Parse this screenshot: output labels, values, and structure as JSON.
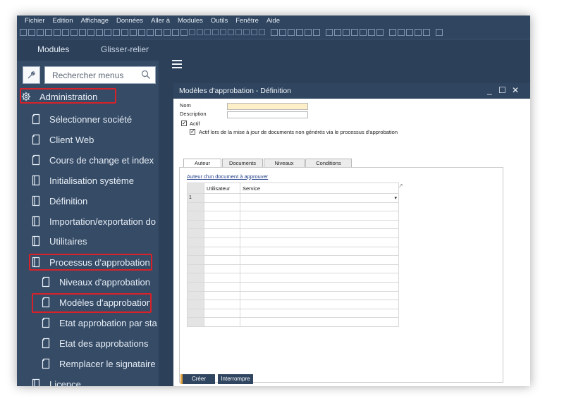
{
  "menubar": {
    "items": [
      "Fichier",
      "Edition",
      "Affichage",
      "Données",
      "Aller à",
      "Modules",
      "Outils",
      "Fenêtre",
      "Aide"
    ]
  },
  "sidebar": {
    "tabs": {
      "active": "Modules",
      "other": "Glisser-relier"
    },
    "search_placeholder": "Rechercher menus",
    "items": [
      {
        "label": "Administration",
        "level": 0,
        "icon": "gear-icon",
        "highlighted": true
      },
      {
        "label": "Sélectionner société",
        "level": 1,
        "icon": "document-icon"
      },
      {
        "label": "Client Web",
        "level": 1,
        "icon": "document-icon"
      },
      {
        "label": "Cours de change et index",
        "level": 1,
        "icon": "document-icon"
      },
      {
        "label": "Initialisation système",
        "level": 1,
        "icon": "folder-icon"
      },
      {
        "label": "Définition",
        "level": 1,
        "icon": "folder-icon"
      },
      {
        "label": "Importation/exportation do",
        "level": 1,
        "icon": "folder-icon"
      },
      {
        "label": "Utilitaires",
        "level": 1,
        "icon": "folder-icon"
      },
      {
        "label": "Processus d'approbation",
        "level": 1,
        "icon": "folder-icon",
        "highlighted": true
      },
      {
        "label": "Niveaux d'approbation",
        "level": 2,
        "icon": "document-icon"
      },
      {
        "label": "Modèles d'approbation",
        "level": 2,
        "icon": "document-icon",
        "highlighted": true
      },
      {
        "label": "Etat approbation par sta",
        "level": 2,
        "icon": "document-icon"
      },
      {
        "label": "Etat des approbations",
        "level": 2,
        "icon": "document-icon"
      },
      {
        "label": "Remplacer le signataire",
        "level": 2,
        "icon": "document-icon"
      },
      {
        "label": "Licence",
        "level": 1,
        "icon": "folder-icon"
      }
    ]
  },
  "window": {
    "title": "Modèles d'approbation - Définition",
    "controls": {
      "minimize": "_",
      "maximize": "☐",
      "close": "✕"
    },
    "fields": {
      "nom_label": "Nom",
      "nom_value": "",
      "description_label": "Description",
      "description_value": ""
    },
    "checkboxes": {
      "actif_label": "Actif",
      "actif_checked": true,
      "mise_a_jour_label": "Actif lors de la mise à jour de documents non générés via le processus d'approbation",
      "mise_a_jour_checked": true
    },
    "tabs": [
      {
        "label": "Auteur",
        "active": true
      },
      {
        "label": "Documents",
        "active": false
      },
      {
        "label": "Niveaux",
        "active": false
      },
      {
        "label": "Conditions",
        "active": false
      }
    ],
    "section_link": "Auteur d'un document à approuver",
    "table": {
      "headers": [
        "",
        "Utilisateur",
        "Service"
      ],
      "rows": [
        [
          "1",
          "",
          ""
        ],
        [
          "",
          "",
          ""
        ],
        [
          "",
          "",
          ""
        ],
        [
          "",
          "",
          ""
        ],
        [
          "",
          "",
          ""
        ],
        [
          "",
          "",
          ""
        ],
        [
          "",
          "",
          ""
        ],
        [
          "",
          "",
          ""
        ],
        [
          "",
          "",
          ""
        ],
        [
          "",
          "",
          ""
        ],
        [
          "",
          "",
          ""
        ],
        [
          "",
          "",
          ""
        ],
        [
          "",
          "",
          ""
        ],
        [
          "",
          "",
          ""
        ],
        [
          "",
          "",
          ""
        ]
      ],
      "dropdown_glyph": "▾",
      "corner_glyph": "↗"
    },
    "buttons": {
      "create": "Créer",
      "cancel": "Interrompre"
    }
  },
  "colors": {
    "sidebar_bg": "#354b66",
    "header_bg": "#2c4059",
    "highlight": "#d8222a",
    "input_highlight": "#fdf0c8"
  }
}
